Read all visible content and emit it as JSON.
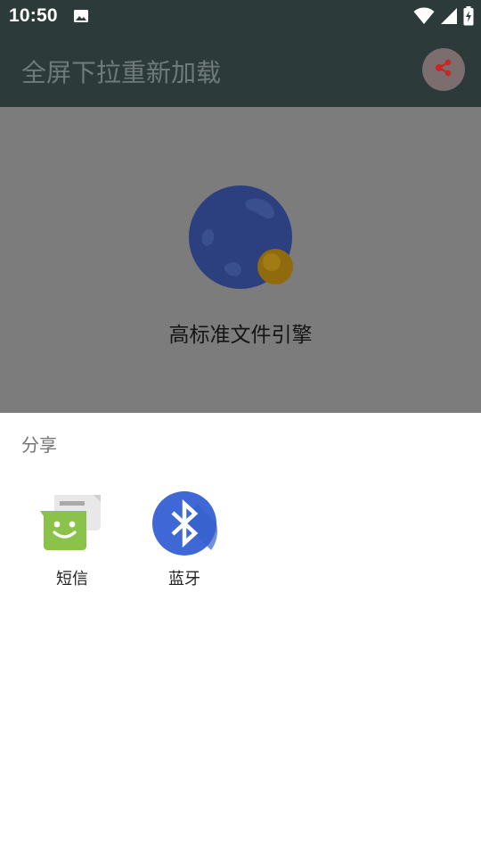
{
  "status_bar": {
    "time": "10:50",
    "icons": [
      "image-icon",
      "wifi-icon",
      "signal-icon",
      "battery-charging-icon"
    ]
  },
  "toolbar": {
    "title": "全屏下拉重新加载",
    "share_icon": "share-icon"
  },
  "content": {
    "app_name": "高标准文件引擎",
    "logo_icon": "globe-logo-icon"
  },
  "share_sheet": {
    "title": "分享",
    "targets": [
      {
        "label": "短信",
        "icon": "messaging-icon"
      },
      {
        "label": "蓝牙",
        "icon": "bluetooth-icon"
      }
    ]
  },
  "colors": {
    "toolbar_bg": "#2c3b3a",
    "scrim_content_bg": "#7c7c7c",
    "share_accent": "#c62828",
    "bluetooth_blue": "#3f68d6",
    "messaging_green": "#8bc34a"
  }
}
